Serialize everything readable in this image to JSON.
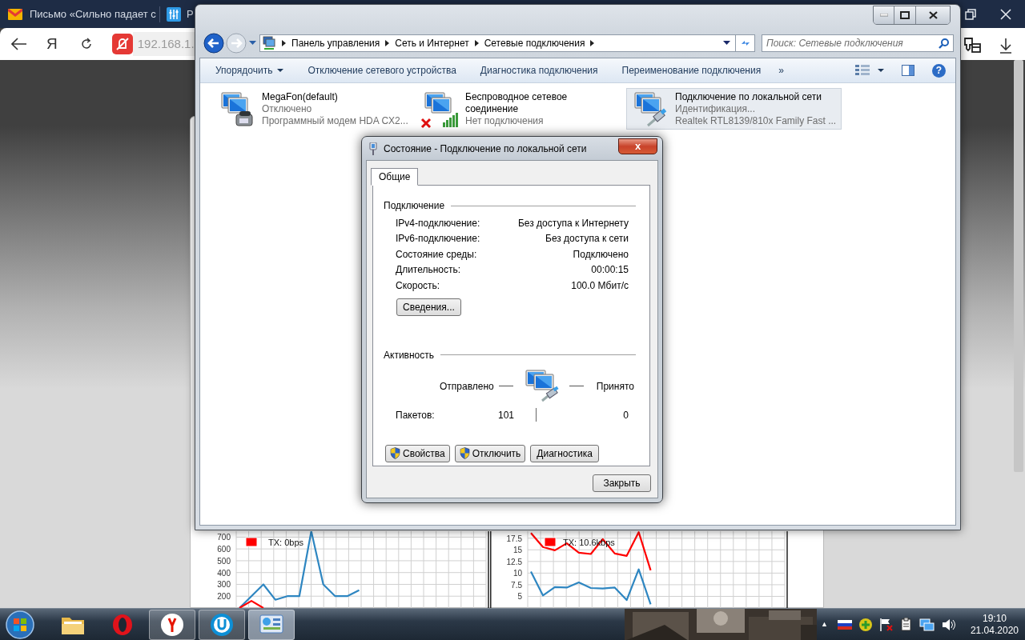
{
  "browser": {
    "tabs": [
      {
        "title": "Письмо «Сильно падает с",
        "kind": "mail",
        "selected": false
      },
      {
        "title": "Р",
        "kind": "router",
        "selected": false
      }
    ],
    "home_button": "Я",
    "address": "192.168.1."
  },
  "explorer": {
    "breadcrumb": [
      "Панель управления",
      "Сеть и Интернет",
      "Сетевые подключения"
    ],
    "search_placeholder": "Поиск: Сетевые подключения",
    "toolbar": [
      {
        "label": "Упорядочить",
        "dropdown": true
      },
      {
        "label": "Отключение сетевого устройства",
        "dropdown": false
      },
      {
        "label": "Диагностика подключения",
        "dropdown": false
      },
      {
        "label": "Переименование подключения",
        "dropdown": false
      },
      {
        "label": "»",
        "dropdown": false
      }
    ],
    "help": "?",
    "connections": [
      {
        "name": "MegaFon(default)",
        "status": "Отключено",
        "device": "Программный модем HDA CX2...",
        "kind": "modem",
        "selected": false,
        "disconnected": false
      },
      {
        "name": "Беспроводное сетевое соединение",
        "status": "Нет подключения",
        "kind": "wireless",
        "selected": false,
        "disconnected": true
      },
      {
        "name": "Подключение по локальной сети",
        "status": "Идентификация...",
        "device": "Realtek RTL8139/810x Family Fast ...",
        "kind": "ethernet",
        "selected": true,
        "disconnected": false
      }
    ]
  },
  "dialog": {
    "title": "Состояние - Подключение по локальной сети",
    "close": "x",
    "tabs": [
      {
        "label": "Общие",
        "selected": true
      }
    ],
    "connection_heading": "Подключение",
    "rows": [
      {
        "label": "IPv4-подключение:",
        "value": "Без доступа к Интернету"
      },
      {
        "label": "IPv6-подключение:",
        "value": "Без доступа к сети"
      },
      {
        "label": "Состояние среды:",
        "value": "Подключено"
      },
      {
        "label": "Длительность:",
        "value": "00:00:15"
      },
      {
        "label": "Скорость:",
        "value": "100.0 Мбит/с"
      }
    ],
    "details_button": "Сведения...",
    "activity_heading": "Активность",
    "sent_label": "Отправлено",
    "received_label": "Принято",
    "packets_label": "Пакетов:",
    "packets_sent": "101",
    "packets_received": "0",
    "buttons": [
      {
        "label": "Свойства",
        "shield": true
      },
      {
        "label": "Отключить",
        "shield": true
      },
      {
        "label": "Диагностика",
        "shield": false
      }
    ],
    "close_button": "Закрыть"
  },
  "charts": [
    {
      "chart_data": {
        "type": "line",
        "grid": true,
        "ylim": [
          100,
          750
        ],
        "yticks": [
          200,
          300,
          400,
          500,
          600,
          700
        ],
        "series": [
          {
            "color": "#2e86c1",
            "values": [
              100,
              200,
              300,
              170,
              200,
              200,
              750,
              300,
              200,
              200,
              250,
              null,
              null,
              null,
              null,
              null,
              null,
              null,
              null,
              null,
              null
            ]
          },
          {
            "name": "TX: 0bps",
            "color": "#ff0000",
            "values": [
              100,
              160,
              100,
              null,
              null,
              null,
              null,
              null,
              null,
              null,
              null,
              null,
              null,
              null,
              null,
              null,
              null,
              null,
              null,
              null,
              null
            ]
          }
        ]
      }
    },
    {
      "chart_data": {
        "type": "line",
        "grid": true,
        "ylim": [
          2.5,
          19
        ],
        "yticks": [
          5,
          7.5,
          10,
          12.5,
          15,
          17.5
        ],
        "series": [
          {
            "color": "#2e86c1",
            "values": [
              10.3,
              5.2,
              7,
              6.9,
              8,
              6.8,
              6.7,
              6.9,
              4.2,
              10.8,
              3.3,
              null,
              null,
              null,
              null,
              null,
              null,
              null,
              null,
              null,
              null
            ]
          },
          {
            "name": "TX: 10.6kbps",
            "color": "#ff0000",
            "values": [
              18.6,
              15.6,
              14.9,
              16.4,
              14.4,
              14.1,
              17.3,
              14.2,
              13.7,
              18.8,
              10.6,
              null,
              null,
              null,
              null,
              null,
              null,
              null,
              null,
              null,
              null
            ]
          }
        ]
      }
    }
  ],
  "taskbar": {
    "apps": [
      {
        "kind": "folder",
        "running": false,
        "selected": false
      },
      {
        "kind": "opera",
        "running": false,
        "selected": false
      },
      {
        "kind": "yandex",
        "running": true,
        "selected": false
      },
      {
        "kind": "u",
        "running": true,
        "selected": false
      },
      {
        "kind": "control_panel",
        "running": true,
        "selected": true
      }
    ],
    "tray_arrow": "▲",
    "time": "19:10",
    "date": "21.04.2020"
  }
}
